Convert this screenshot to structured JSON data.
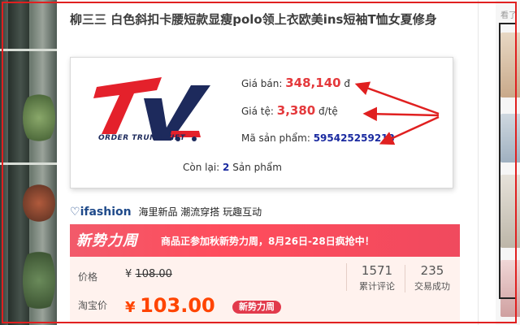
{
  "product": {
    "title": "柳三三 白色斜扣卡腰短款显瘦polo领上衣欧美ins短袖T恤女夏修身"
  },
  "info_box": {
    "logo_text": "ORDER TRUNG VIET",
    "sale_price_label": "Giá bán:",
    "sale_price_value": "348,140",
    "sale_price_unit": "đ",
    "rate_label": "Giá tệ:",
    "rate_value": "3,380",
    "rate_unit": "đ/tệ",
    "sku_label": "Mã sản phẩm:",
    "sku_value": "595425259213",
    "stock_label": "Còn lại:",
    "stock_value": "2",
    "stock_unit": "Sản phẩm"
  },
  "ifashion": {
    "brand": "ifashion",
    "tagline": "海里新品 潮流穿搭 玩趣互动"
  },
  "banner": {
    "left_text": "新势力周",
    "right_text": "商品正参加秋新势力周，8月26日-28日疯抢中！"
  },
  "pricing": {
    "original_label": "价格",
    "original_currency": "¥",
    "original_price": "108.00",
    "current_label": "淘宝价",
    "current_currency": "¥",
    "current_price": "103.00",
    "promo_tag": "新势力周",
    "reviews_count": "1571",
    "reviews_label": "累计评论",
    "sales_count": "235",
    "sales_label": "交易成功"
  },
  "sidebar_right": {
    "label": "看了"
  },
  "colors": {
    "accent_red": "#e4393c",
    "price_orange": "#ff4400",
    "sku_blue": "#1a2aa0",
    "brand_navy": "#1d2a5c",
    "annotation_red": "#e02020"
  }
}
